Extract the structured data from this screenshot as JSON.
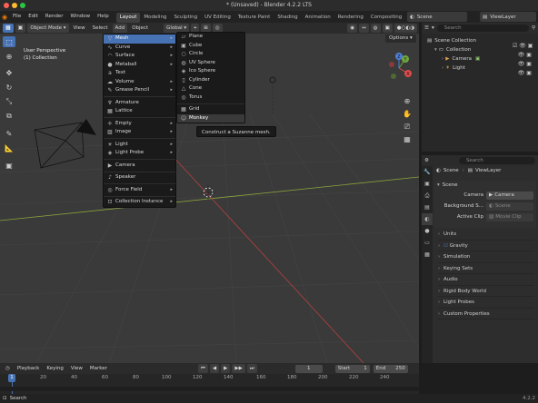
{
  "window": {
    "title": "* (Unsaved) - Blender 4.2.2 LTS"
  },
  "topmenu": {
    "items": [
      "File",
      "Edit",
      "Render",
      "Window",
      "Help"
    ],
    "workspaces": [
      "Layout",
      "Modeling",
      "Sculpting",
      "UV Editing",
      "Texture Paint",
      "Shading",
      "Animation",
      "Rendering",
      "Compositing"
    ],
    "active_workspace": "Layout",
    "scene": "Scene",
    "viewlayer": "ViewLayer"
  },
  "viewport_header": {
    "mode": "Object Mode",
    "menus": [
      "View",
      "Select",
      "Add",
      "Object"
    ],
    "transform": "Global",
    "options": "Options"
  },
  "overlay": {
    "perspective": "User Perspective",
    "collection": "(1) Collection"
  },
  "gizmo": {
    "x": "X",
    "y": "Y",
    "z": "Z"
  },
  "add_menu": [
    {
      "label": "Mesh",
      "icon": "mesh-icon",
      "submenu": true
    },
    {
      "label": "Curve",
      "icon": "curve-icon",
      "submenu": true
    },
    {
      "label": "Surface",
      "icon": "surface-icon",
      "submenu": true
    },
    {
      "label": "Metaball",
      "icon": "metaball-icon",
      "submenu": true
    },
    {
      "label": "Text",
      "icon": "text-icon",
      "submenu": false
    },
    {
      "label": "Volume",
      "icon": "volume-icon",
      "submenu": true
    },
    {
      "label": "Grease Pencil",
      "icon": "grease-pencil-icon",
      "submenu": true
    },
    {
      "label": "Armature",
      "icon": "armature-icon",
      "submenu": false
    },
    {
      "label": "Lattice",
      "icon": "lattice-icon",
      "submenu": false
    },
    {
      "label": "Empty",
      "icon": "empty-icon",
      "submenu": true
    },
    {
      "label": "Image",
      "icon": "image-icon",
      "submenu": true
    },
    {
      "label": "Light",
      "icon": "light-icon",
      "submenu": true
    },
    {
      "label": "Light Probe",
      "icon": "light-probe-icon",
      "submenu": true
    },
    {
      "label": "Camera",
      "icon": "camera-icon",
      "submenu": false
    },
    {
      "label": "Speaker",
      "icon": "speaker-icon",
      "submenu": false
    },
    {
      "label": "Force Field",
      "icon": "force-field-icon",
      "submenu": true
    },
    {
      "label": "Collection Instance",
      "icon": "collection-instance-icon",
      "submenu": true
    }
  ],
  "mesh_menu": [
    "Plane",
    "Cube",
    "Circle",
    "UV Sphere",
    "Ico Sphere",
    "Cylinder",
    "Cone",
    "Torus",
    "Grid",
    "Monkey"
  ],
  "tooltip": "Construct a Suzanne mesh.",
  "outliner": {
    "search_placeholder": "Search",
    "root": "Scene Collection",
    "collection": "Collection",
    "items": [
      "Camera",
      "Light"
    ]
  },
  "properties": {
    "search_placeholder": "Search",
    "breadcrumb_scene": "Scene",
    "breadcrumb_viewlayer": "ViewLayer",
    "panel_scene": "Scene",
    "camera_label": "Camera",
    "camera_value": "Camera",
    "bg_label": "Background S...",
    "bg_value": "Scene",
    "clip_label": "Active Clip",
    "clip_value": "Movie Clip",
    "panels": [
      "Units",
      "Gravity",
      "Simulation",
      "Keying Sets",
      "Audio",
      "Rigid Body World",
      "Light Probes",
      "Custom Properties"
    ]
  },
  "timeline": {
    "menus": [
      "Playback",
      "Keying",
      "View",
      "Marker"
    ],
    "current_frame": "1",
    "start_label": "Start",
    "start": "1",
    "end_label": "End",
    "end": "250",
    "ticks": [
      "1",
      "20",
      "40",
      "60",
      "80",
      "100",
      "120",
      "140",
      "160",
      "180",
      "200",
      "220",
      "240"
    ]
  },
  "status": {
    "search": "Search",
    "version": "4.2.2"
  }
}
